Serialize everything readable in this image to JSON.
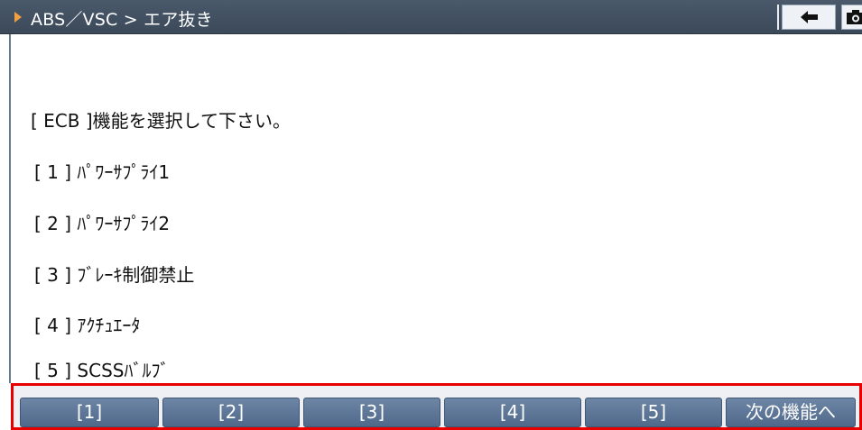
{
  "header": {
    "title": "ABS／VSC > エア抜き",
    "icons": {
      "arrow": "play-triangle-icon",
      "back": "back-arrow-icon",
      "camera": "camera-icon"
    },
    "colors": {
      "bar": "#3e4c5d",
      "accent": "#f0a040"
    }
  },
  "main": {
    "prompt": "[ ECB ]機能を選択して下さい。",
    "items": [
      {
        "label": "[ 1 ] ﾊﾟﾜｰｻﾌﾟﾗｲ1"
      },
      {
        "label": "[ 2 ] ﾊﾟﾜｰｻﾌﾟﾗｲ2"
      },
      {
        "label": "[ 3 ] ﾌﾞﾚｰｷ制御禁止"
      },
      {
        "label": "[ 4 ] ｱｸﾁｭｴｰﾀ"
      },
      {
        "label": "[ 5 ] SCSSﾊﾞﾙﾌﾞ"
      }
    ]
  },
  "footer": {
    "buttons": [
      {
        "label": "[1]"
      },
      {
        "label": "[2]"
      },
      {
        "label": "[3]"
      },
      {
        "label": "[4]"
      },
      {
        "label": "[5]"
      },
      {
        "label": "次の機能へ"
      }
    ],
    "highlight_color": "#e80000"
  }
}
